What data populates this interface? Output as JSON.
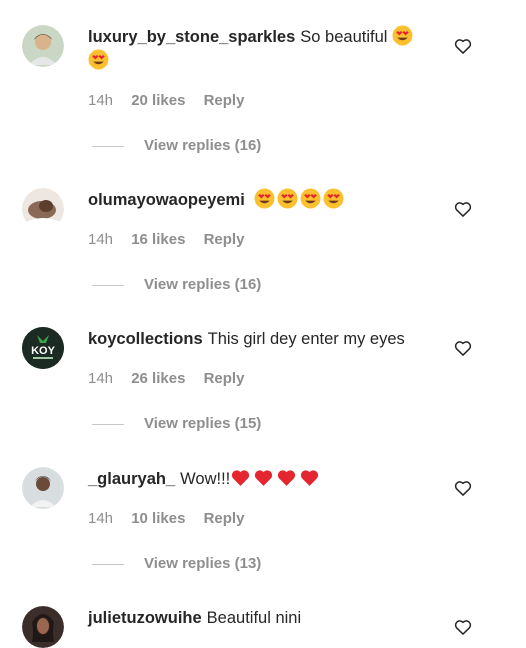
{
  "comments": [
    {
      "username": "luxury_by_stone_sparkles",
      "text": "So beautiful",
      "emoji": [
        "heart-eyes-emoji",
        "heart-eyes-emoji"
      ],
      "time": "14h",
      "likes": "20 likes",
      "reply": "Reply",
      "view_replies": "View replies (16)"
    },
    {
      "username": "olumayowaopeyemi",
      "text": "",
      "emoji": [
        "heart-eyes-emoji",
        "heart-eyes-emoji",
        "heart-eyes-emoji",
        "heart-eyes-emoji"
      ],
      "time": "14h",
      "likes": "16 likes",
      "reply": "Reply",
      "view_replies": "View replies (16)"
    },
    {
      "username": "koycollections",
      "text": "This girl dey enter my eyes",
      "avatar_text": "KOY",
      "time": "14h",
      "likes": "26 likes",
      "reply": "Reply",
      "view_replies": "View replies (15)"
    },
    {
      "username": "_glauryah_",
      "text": "Wow!!!",
      "emoji": [
        "red-heart-emoji",
        "red-heart-emoji",
        "red-heart-emoji",
        "red-heart-emoji"
      ],
      "time": "14h",
      "likes": "10 likes",
      "reply": "Reply",
      "view_replies": "View replies (13)"
    },
    {
      "username": "julietuzowuihe",
      "text": "Beautiful nini"
    }
  ],
  "colors": {
    "primary_text": "#262626",
    "secondary_text": "#8e8e8e",
    "heart_red": "#e3262f",
    "emoji_yellow": "#fbc02d"
  },
  "icons": {
    "like": "heart-outline-icon"
  }
}
